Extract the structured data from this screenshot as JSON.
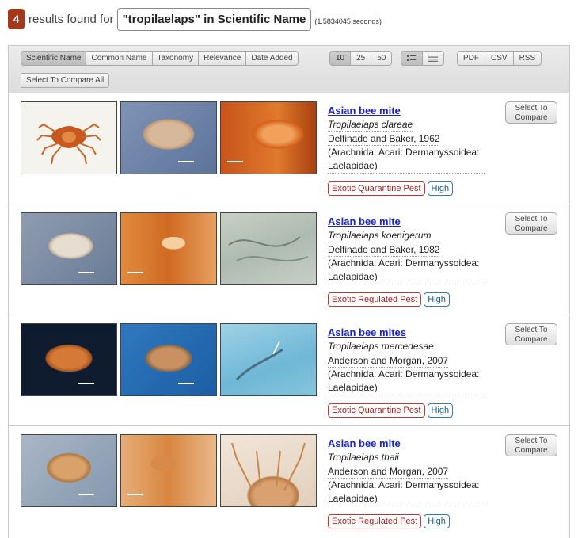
{
  "header": {
    "count": "4",
    "found_text": "results found for",
    "query": "\"tropilaelaps\" in Scientific Name",
    "timing": "(1.5834045 seconds)"
  },
  "toolbar": {
    "sort_options": [
      "Scientific Name",
      "Common Name",
      "Taxonomy",
      "Relevance",
      "Date Added"
    ],
    "sort_active": "Scientific Name",
    "page_sizes": [
      "10",
      "25",
      "50"
    ],
    "page_size_active": "10",
    "views": [
      {
        "icon": "grid-view-icon"
      },
      {
        "icon": "list-view-icon"
      }
    ],
    "exports": [
      "PDF",
      "CSV",
      "RSS"
    ],
    "select_all_label": "Select To Compare All"
  },
  "results": [
    {
      "common_name": "Asian bee mite",
      "scientific_name": "Tropilaelaps clareae",
      "authority": "Delfinado and Baker, 1962",
      "taxonomy": "(Arachnida: Acari: Dermanyssoidea: Laelapidae)",
      "pest_status": "Exotic Quarantine Pest",
      "risk": "High",
      "compare_label": "Select To Compare"
    },
    {
      "common_name": "Asian bee mite",
      "scientific_name": "Tropilaelaps koenigerum",
      "authority": "Delfinado and Baker, 1982",
      "taxonomy": "(Arachnida: Acari: Dermanyssoidea: Laelapidae)",
      "pest_status": "Exotic Regulated Pest",
      "risk": "High",
      "compare_label": "Select To Compare"
    },
    {
      "common_name": "Asian bee mites",
      "scientific_name": "Tropilaelaps mercedesae",
      "authority": "Anderson and Morgan, 2007",
      "taxonomy": "(Arachnida: Acari: Dermanyssoidea: Laelapidae)",
      "pest_status": "Exotic Quarantine Pest",
      "risk": "High",
      "compare_label": "Select To Compare"
    },
    {
      "common_name": "Asian bee mite",
      "scientific_name": "Tropilaelaps thaii",
      "authority": "Anderson and Morgan, 2007",
      "taxonomy": "(Arachnida: Acari: Dermanyssoidea: Laelapidae)",
      "pest_status": "Exotic Regulated Pest",
      "risk": "High",
      "compare_label": "Select To Compare"
    }
  ],
  "colors": {
    "badge_count": "#a3381b",
    "link": "#1b26c2",
    "pest_badge": "#b83838",
    "risk_badge": "#2f7fa8"
  }
}
